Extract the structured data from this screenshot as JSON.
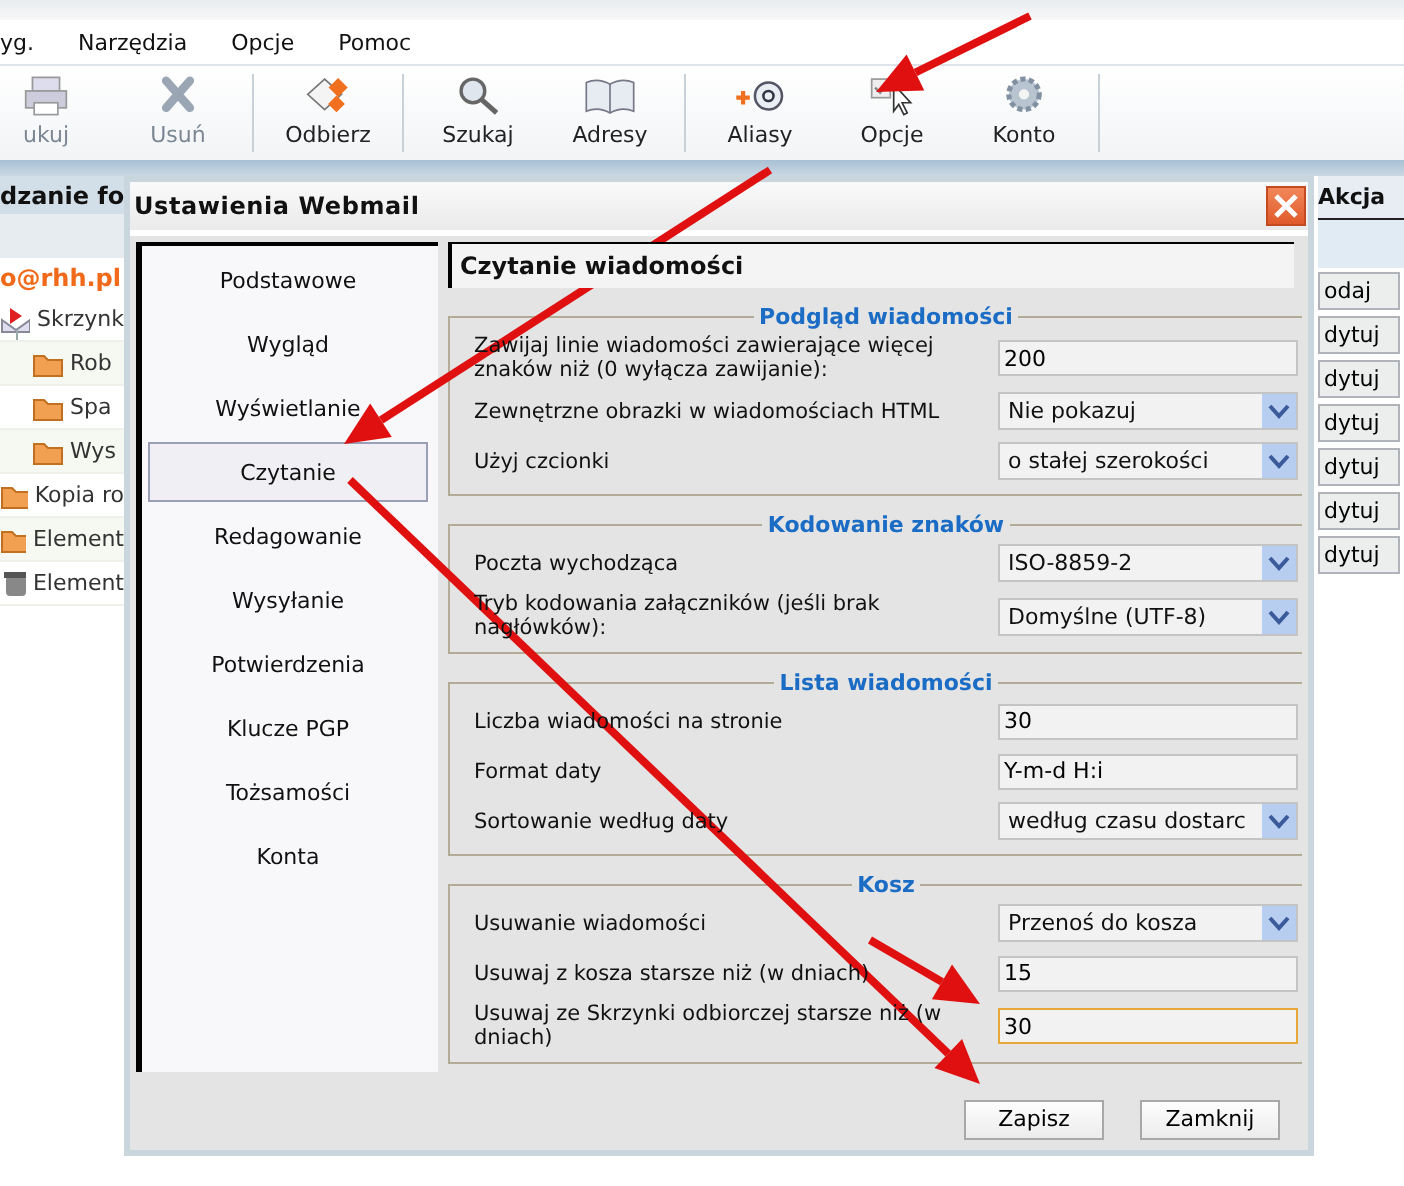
{
  "menu": [
    "yg.",
    "Narzędzia",
    "Opcje",
    "Pomoc"
  ],
  "toolbar": [
    [
      {
        "label": "ukuj",
        "kind": "print",
        "disabled": true
      },
      {
        "label": "Usuń",
        "kind": "delete",
        "disabled": true
      }
    ],
    [
      {
        "label": "Odbierz",
        "kind": "receive",
        "disabled": false
      }
    ],
    [
      {
        "label": "Szukaj",
        "kind": "search",
        "disabled": false
      },
      {
        "label": "Adresy",
        "kind": "addresses",
        "disabled": false
      }
    ],
    [
      {
        "label": "Aliasy",
        "kind": "aliases",
        "disabled": false
      },
      {
        "label": "Opcje",
        "kind": "options",
        "disabled": false
      },
      {
        "label": "Konto",
        "kind": "account",
        "disabled": false
      }
    ]
  ],
  "background": {
    "header": "dzanie fo",
    "account": "o@rhh.pl",
    "folders": [
      {
        "label": "Skrzynk",
        "kind": "inbox",
        "expanded": true,
        "children": [
          {
            "label": "Rob",
            "kind": "folder"
          },
          {
            "label": "Spa",
            "kind": "folder"
          },
          {
            "label": "Wys",
            "kind": "folder"
          }
        ]
      },
      {
        "label": "Kopia ro",
        "kind": "folder"
      },
      {
        "label": "Element",
        "kind": "folder"
      },
      {
        "label": "Element",
        "kind": "trash"
      }
    ],
    "action_header": "Akcja",
    "action_buttons": [
      "odaj",
      "dytuj",
      "dytuj",
      "dytuj",
      "dytuj",
      "dytuj",
      "dytuj"
    ]
  },
  "dialog": {
    "title": "Ustawienia Webmail",
    "nav": [
      {
        "label": "Podstawowe",
        "selected": false
      },
      {
        "label": "Wygląd",
        "selected": false
      },
      {
        "label": "Wyświetlanie",
        "selected": false
      },
      {
        "label": "Czytanie",
        "selected": true
      },
      {
        "label": "Redagowanie",
        "selected": false
      },
      {
        "label": "Wysyłanie",
        "selected": false
      },
      {
        "label": "Potwierdzenia",
        "selected": false
      },
      {
        "label": "Klucze PGP",
        "selected": false
      },
      {
        "label": "Tożsamości",
        "selected": false
      },
      {
        "label": "Konta",
        "selected": false
      }
    ],
    "heading": "Czytanie wiadomości",
    "sections": [
      {
        "title": "Podgląd wiadomości",
        "fields": [
          {
            "label": "Zawijaj linie wiadomości zawierające więcej znaków niż (0 wyłącza zawijanie):",
            "kind": "text",
            "value": "200",
            "focused": false
          },
          {
            "label": "Zewnętrzne obrazki w wiadomościach HTML",
            "kind": "select",
            "value": "Nie pokazuj",
            "focused": false
          },
          {
            "label": "Użyj czcionki",
            "kind": "select",
            "value": "o stałej szerokości",
            "focused": false
          }
        ]
      },
      {
        "title": "Kodowanie znaków",
        "fields": [
          {
            "label": "Poczta wychodząca",
            "kind": "select",
            "value": "ISO-8859-2",
            "focused": false
          },
          {
            "label": "Tryb kodowania załączników (jeśli brak nagłówków):",
            "kind": "select",
            "value": "Domyślne (UTF-8)",
            "focused": false
          }
        ]
      },
      {
        "title": "Lista wiadomości",
        "fields": [
          {
            "label": "Liczba wiadomości na stronie",
            "kind": "text",
            "value": "30",
            "focused": false
          },
          {
            "label": "Format daty",
            "kind": "text",
            "value": "Y-m-d H:i",
            "focused": false
          },
          {
            "label": "Sortowanie według daty",
            "kind": "select",
            "value": "według czasu dostarc",
            "focused": false
          }
        ]
      },
      {
        "title": "Kosz",
        "fields": [
          {
            "label": "Usuwanie wiadomości",
            "kind": "select",
            "value": "Przenoś do kosza",
            "focused": false
          },
          {
            "label": "Usuwaj z kosza starsze niż (w dniach)",
            "kind": "text",
            "value": "15",
            "focused": false
          },
          {
            "label": "Usuwaj ze Skrzynki odbiorczej starsze niż (w dniach)",
            "kind": "text",
            "value": "30",
            "focused": true
          }
        ]
      }
    ],
    "buttons": [
      "Zapisz",
      "Zamknij"
    ]
  }
}
